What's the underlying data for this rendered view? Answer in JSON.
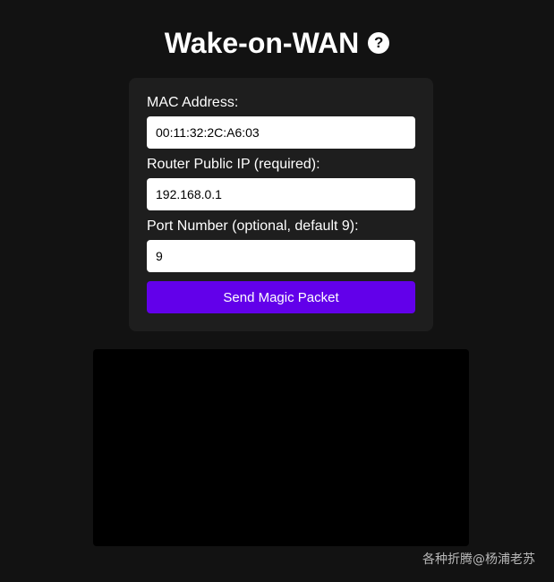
{
  "header": {
    "title": "Wake-on-WAN",
    "help_icon": "help-icon",
    "help_glyph": "?"
  },
  "form": {
    "mac": {
      "label": "MAC Address:",
      "value": "00:11:32:2C:A6:03"
    },
    "router_ip": {
      "label": "Router Public IP (required):",
      "value": "192.168.0.1"
    },
    "port": {
      "label": "Port Number (optional, default 9):",
      "value": "9"
    },
    "submit_label": "Send Magic Packet"
  },
  "output": {
    "text": ""
  },
  "watermark": {
    "text": "各种折腾@杨浦老苏"
  },
  "colors": {
    "background": "#121212",
    "card": "#1e1e1e",
    "accent": "#6200ea",
    "output_bg": "#000000"
  }
}
